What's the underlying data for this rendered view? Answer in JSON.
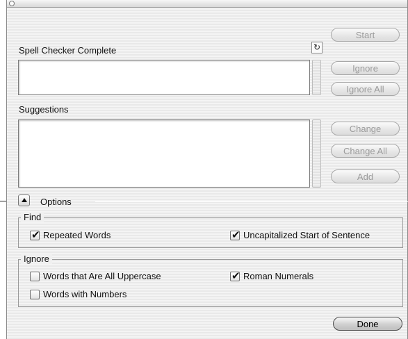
{
  "header": {
    "status_label": "Spell Checker Complete"
  },
  "suggestions": {
    "label": "Suggestions"
  },
  "buttons": {
    "start": "Start",
    "ignore": "Ignore",
    "ignore_all": "Ignore All",
    "change": "Change",
    "change_all": "Change All",
    "add": "Add",
    "done": "Done"
  },
  "options": {
    "label": "Options",
    "find": {
      "title": "Find",
      "repeated_words": {
        "label": "Repeated Words",
        "checked": true
      },
      "uncapitalized": {
        "label": "Uncapitalized Start of Sentence",
        "checked": true
      }
    },
    "ignore": {
      "title": "Ignore",
      "all_uppercase": {
        "label": "Words that Are All Uppercase",
        "checked": false
      },
      "roman_numerals": {
        "label": "Roman Numerals",
        "checked": true
      },
      "with_numbers": {
        "label": "Words with Numbers",
        "checked": false
      }
    }
  }
}
